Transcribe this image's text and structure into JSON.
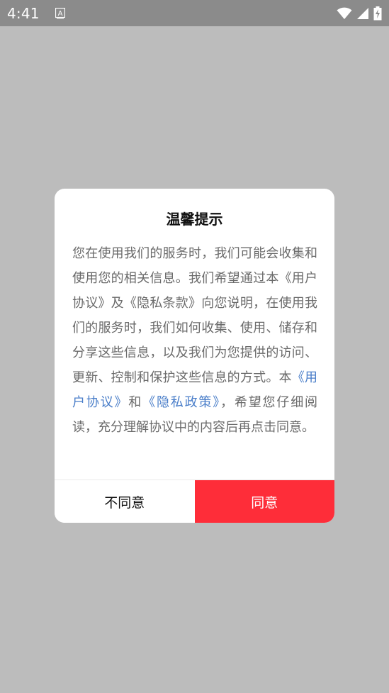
{
  "status_bar": {
    "time": "4:41",
    "icons": [
      "keyboard-a-icon",
      "wifi-icon",
      "signal-icon",
      "battery-charging-icon"
    ],
    "background": "#8b8b8b"
  },
  "dialog": {
    "title": "温馨提示",
    "body_part1": "您在使用我们的服务时，我们可能会收集和使用您的相关信息。我们希望通过本《用户协议》及《隐私条款》向您说明，在使用我们的服务时，我们如何收集、使用、储存和分享这些信息，以及我们为您提供的访问、更新、控制和保护这些信息的方式。本",
    "link_user_agreement": "《用户协议》",
    "body_and": "和",
    "link_privacy_policy": "《隐私政策》",
    "body_part2": "，希望您仔细阅读，充分理解协议中的内容后再点击同意。",
    "decline_label": "不同意",
    "accept_label": "同意"
  },
  "colors": {
    "overlay": "#bcbcbc",
    "accent": "#fe2d39",
    "link": "#4a7ec9"
  }
}
